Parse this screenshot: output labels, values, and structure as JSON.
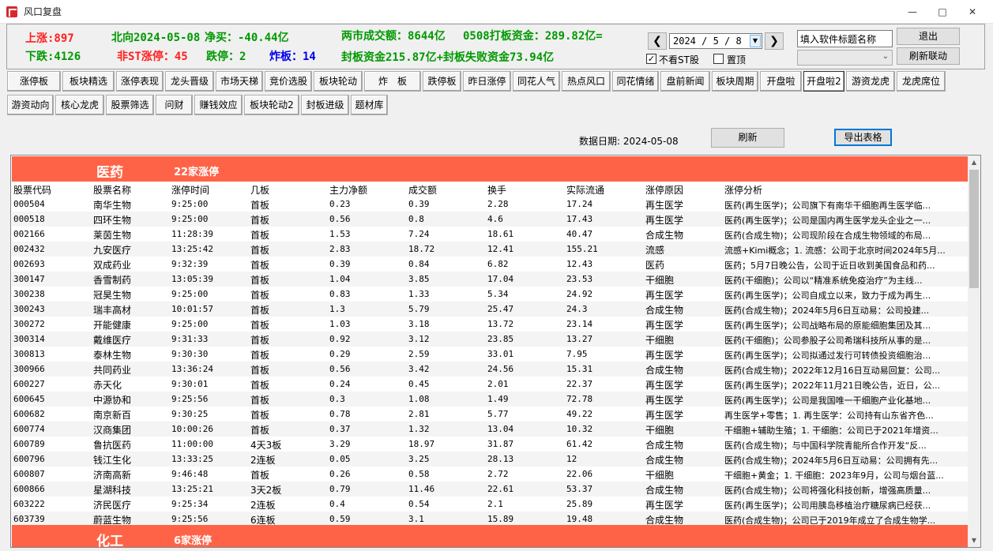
{
  "window": {
    "title": "风口复盘"
  },
  "summary": {
    "up": "上涨:897",
    "down": "下跌:4126",
    "north": "北向2024-05-08",
    "net_buy": "净买：-40.44亿",
    "non_st_limit_up": "非ST涨停：45",
    "limit_down": "跌停：2",
    "broken": "炸板：14",
    "turnover": "两市成交额：8644亿",
    "board_funds": "0508打板资金：289.82亿=",
    "seal_funds": "封板资金215.87亿+封板失败资金73.94亿"
  },
  "controls": {
    "date_value": "2024 / 5 / 8",
    "no_st_label": "不看ST股",
    "no_st_checked": "✓",
    "pin_label": "置顶",
    "title_input_value": "填入软件标题名称",
    "exit_label": "退出",
    "refresh_link_label": "刷新联动"
  },
  "tabs_row1": [
    "涨停板",
    "板块精选",
    "涨停表现",
    "龙头晋级",
    "市场天梯",
    "竞价选股",
    "板块轮动",
    "炸　板",
    "跌停板",
    "昨日涨停",
    "同花人气",
    "热点风口",
    "同花情绪",
    "盘前新闻",
    "板块周期",
    "开盘啦",
    "开盘啦2",
    "游资龙虎",
    "龙虎席位"
  ],
  "tabs_row2": [
    "游资动向",
    "核心龙虎",
    "股票筛选",
    "问财",
    "赚钱效应",
    "板块轮动2",
    "封板进级",
    "题材库"
  ],
  "data_date": "数据日期: 2024-05-08",
  "refresh_label": "刷新",
  "export_label": "导出表格",
  "table": {
    "sector": "医药",
    "sector_count": "22家涨停",
    "next_sector": "化工",
    "next_sector_count": "6家涨停",
    "headers": [
      "股票代码",
      "股票名称",
      "涨停时间",
      "几板",
      "主力净额",
      "成交额",
      "换手",
      "实际流通",
      "涨停原因",
      "涨停分析"
    ],
    "rows": [
      [
        "000504",
        "南华生物",
        "9:25:00",
        "首板",
        "0.23",
        "0.39",
        "2.28",
        "17.24",
        "再生医学",
        "医药(再生医学)；公司旗下有南华干细胞再生医学临..."
      ],
      [
        "000518",
        "四环生物",
        "9:25:00",
        "首板",
        "0.56",
        "0.8",
        "4.6",
        "17.43",
        "再生医学",
        "医药(再生医学)；公司是国内再生医学龙头企业之一..."
      ],
      [
        "002166",
        "莱茵生物",
        "11:28:39",
        "首板",
        "1.53",
        "7.24",
        "18.61",
        "40.47",
        "合成生物",
        "医药(合成生物)；公司现阶段在合成生物领域的布局..."
      ],
      [
        "002432",
        "九安医疗",
        "13:25:42",
        "首板",
        "2.83",
        "18.72",
        "12.41",
        "155.21",
        "流感",
        "流感+Kimi概念；1. 流感：公司于北京时间2024年5月..."
      ],
      [
        "002693",
        "双成药业",
        "9:32:39",
        "首板",
        "0.39",
        "0.84",
        "6.82",
        "12.43",
        "医药",
        "医药；5月7日晚公告，公司于近日收到美国食品和药..."
      ],
      [
        "300147",
        "香雪制药",
        "13:05:39",
        "首板",
        "1.04",
        "3.85",
        "17.04",
        "23.53",
        "干细胞",
        "医药(干细胞)；公司以“精准系统免疫治疗”为主线..."
      ],
      [
        "300238",
        "冠昊生物",
        "9:25:00",
        "首板",
        "0.83",
        "1.33",
        "5.34",
        "24.92",
        "再生医学",
        "医药(再生医学)；公司自成立以来，致力于成为再生..."
      ],
      [
        "300243",
        "瑞丰高材",
        "10:01:57",
        "首板",
        "1.3",
        "5.79",
        "25.47",
        "24.3",
        "合成生物",
        "医药(合成生物)；2024年5月6日互动易：公司投建..."
      ],
      [
        "300272",
        "开能健康",
        "9:25:00",
        "首板",
        "1.03",
        "3.18",
        "13.72",
        "23.14",
        "再生医学",
        "医药(再生医学)；公司战略布局的原能细胞集团及其..."
      ],
      [
        "300314",
        "戴维医疗",
        "9:31:33",
        "首板",
        "0.92",
        "3.12",
        "23.85",
        "13.27",
        "干细胞",
        "医药(干细胞)；公司参股子公司希瑞科技所从事的是..."
      ],
      [
        "300813",
        "泰林生物",
        "9:30:30",
        "首板",
        "0.29",
        "2.59",
        "33.01",
        "7.95",
        "再生医学",
        "医药(再生医学)；公司拟通过发行可转债投资细胞治..."
      ],
      [
        "300966",
        "共同药业",
        "13:36:24",
        "首板",
        "0.56",
        "3.42",
        "24.56",
        "15.31",
        "合成生物",
        "医药(合成生物)；2022年12月16日互动易回复：公司..."
      ],
      [
        "600227",
        "赤天化",
        "9:30:01",
        "首板",
        "0.24",
        "0.45",
        "2.01",
        "22.37",
        "再生医学",
        "医药(再生医学)；2022年11月21日晚公告，近日，公..."
      ],
      [
        "600645",
        "中源协和",
        "9:25:56",
        "首板",
        "0.3",
        "1.08",
        "1.49",
        "72.78",
        "再生医学",
        "医药(再生医学)；公司是我国唯一干细胞产业化基地..."
      ],
      [
        "600682",
        "南京新百",
        "9:30:25",
        "首板",
        "0.78",
        "2.81",
        "5.77",
        "49.22",
        "再生医学",
        "再生医学+零售；1. 再生医学：公司持有山东省齐色..."
      ],
      [
        "600774",
        "汉商集团",
        "10:00:26",
        "首板",
        "0.37",
        "1.32",
        "13.04",
        "10.32",
        "干细胞",
        "干细胞+辅助生殖；1. 干细胞：公司已于2021年增资..."
      ],
      [
        "600789",
        "鲁抗医药",
        "11:00:00",
        "4天3板",
        "3.29",
        "18.97",
        "31.87",
        "61.42",
        "合成生物",
        "医药(合成生物)；与中国科学院青能所合作开发“反..."
      ],
      [
        "600796",
        "钱江生化",
        "13:33:25",
        "2连板",
        "0.05",
        "3.25",
        "28.13",
        "12",
        "合成生物",
        "医药(合成生物)；2024年5月6日互动易：公司拥有先..."
      ],
      [
        "600807",
        "济南高新",
        "9:46:48",
        "首板",
        "0.26",
        "0.58",
        "2.72",
        "22.06",
        "干细胞",
        "干细胞+黄金；1. 干细胞：2023年9月，公司与烟台蓝..."
      ],
      [
        "600866",
        "星湖科技",
        "13:25:21",
        "3天2板",
        "0.79",
        "11.46",
        "22.61",
        "53.37",
        "合成生物",
        "医药(合成生物)；公司将强化科技创新，增强高质量..."
      ],
      [
        "603222",
        "济民医疗",
        "9:25:34",
        "2连板",
        "0.4",
        "0.54",
        "2.1",
        "25.89",
        "再生医学",
        "医药(再生医学)；公司用胰岛移植治疗糖尿病已经获..."
      ],
      [
        "603739",
        "蔚蓝生物",
        "9:25:56",
        "6连板",
        "0.59",
        "3.1",
        "15.89",
        "19.48",
        "合成生物",
        "医药(合成生物)；公司已于2019年成立了合成生物学..."
      ]
    ]
  },
  "colors": {
    "sector_bg": "#ff6347",
    "up_red": "#ff2020",
    "down_green": "#009900",
    "blue": "#0000ee"
  }
}
